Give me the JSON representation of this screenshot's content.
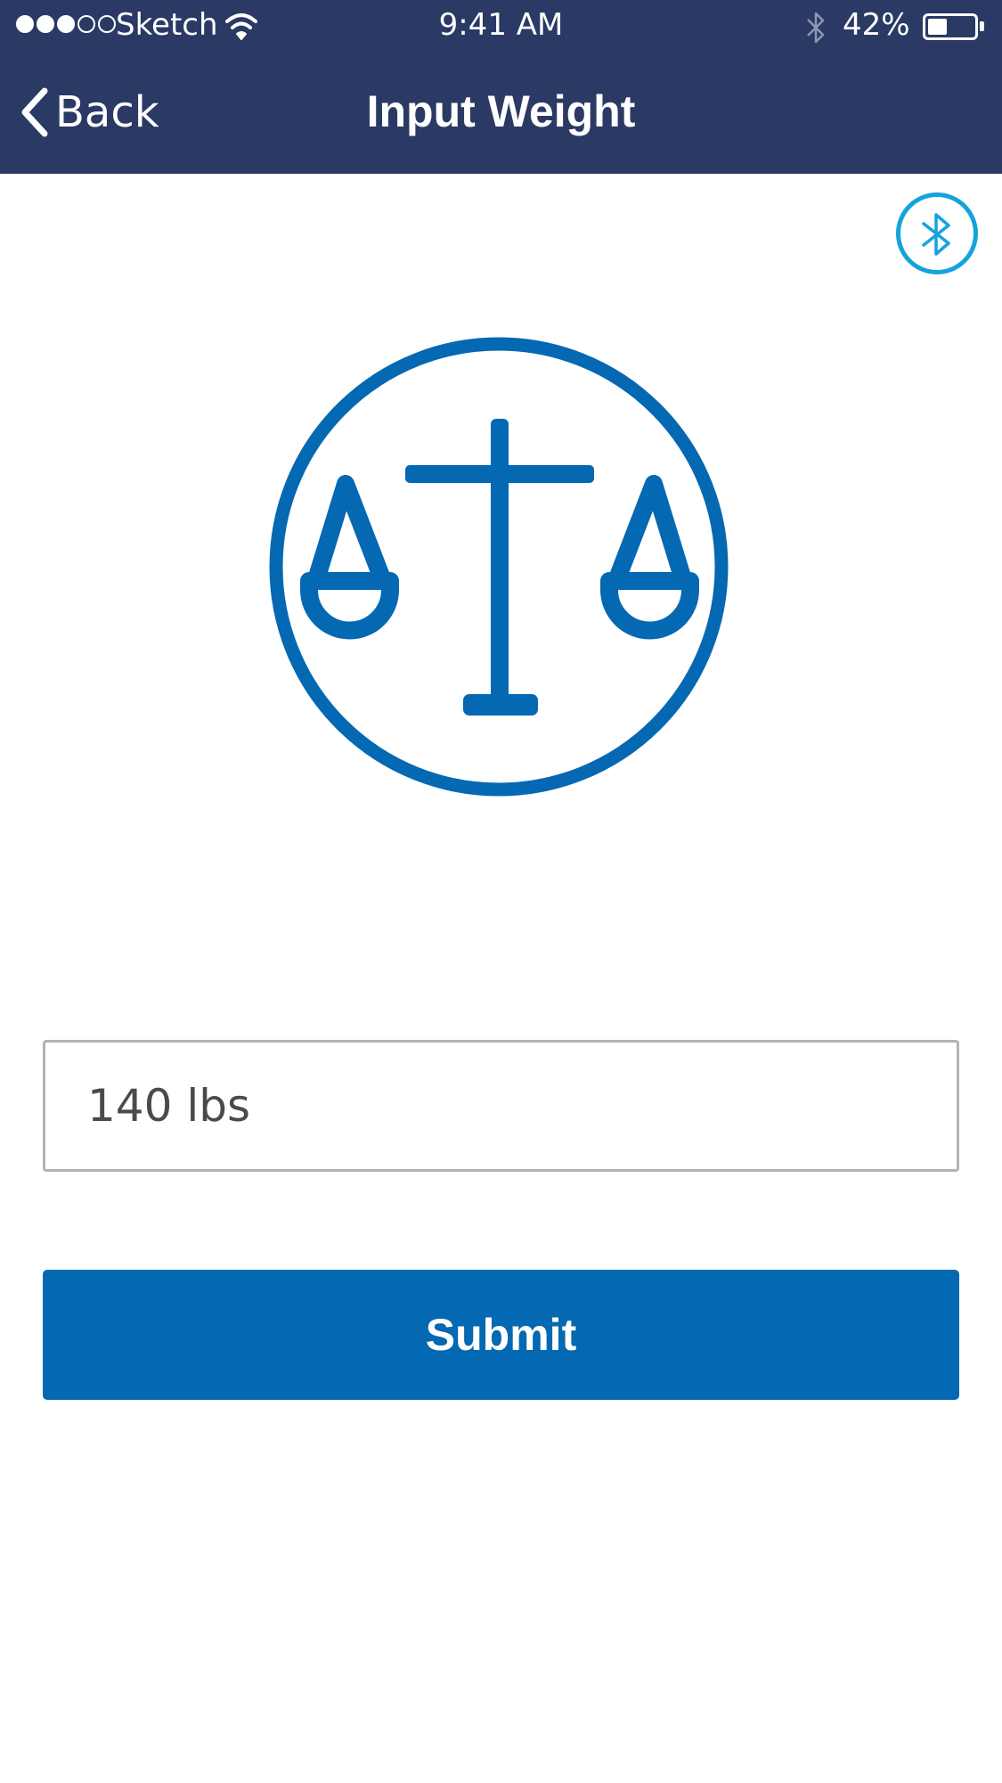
{
  "status_bar": {
    "carrier": "Sketch",
    "time": "9:41 AM",
    "battery_percent": "42%",
    "battery_level": 0.42,
    "signal_bars_filled": 3,
    "signal_bars_total": 5
  },
  "nav": {
    "back_label": "Back",
    "title": "Input Weight"
  },
  "icons": {
    "bluetooth": "bluetooth-icon",
    "scale": "scale-icon",
    "back": "chevron-left-icon"
  },
  "weight_field": {
    "value": "140 lbs"
  },
  "submit": {
    "label": "Submit"
  },
  "colors": {
    "header": "#2b3965",
    "accent": "#0468b2",
    "bluetooth": "#15a3dc",
    "input_border": "#b3b3b3"
  }
}
